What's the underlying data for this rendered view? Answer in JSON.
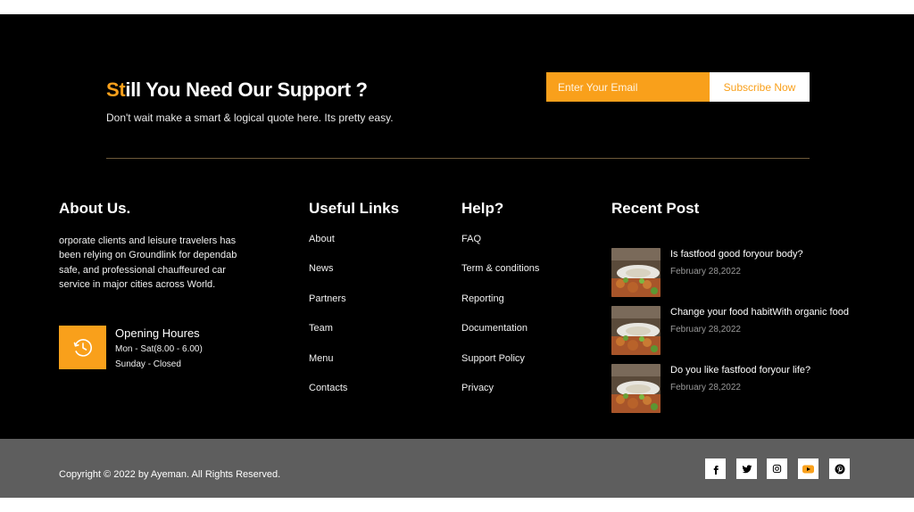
{
  "support": {
    "title_accent": "St",
    "title_rest": "ill You Need Our Support ?",
    "subtitle": "Don't wait make a smart & logical quote here. Its pretty easy.",
    "email_placeholder": "Enter Your Email",
    "subscribe_label": "Subscribe Now"
  },
  "about": {
    "title": "About Us.",
    "text": "orporate clients and leisure travelers has been relying on Groundlink for dependab safe, and professional chauffeured car service in major cities across World.",
    "hours_icon": "clock-icon",
    "hours_title": "Opening Houres",
    "hours_line1": "Mon - Sat(8.00 - 6.00)",
    "hours_line2": "Sunday - Closed"
  },
  "useful_links": {
    "title": "Useful Links",
    "items": [
      "About",
      "News",
      "Partners",
      "Team",
      "Menu",
      "Contacts"
    ]
  },
  "help": {
    "title": "Help?",
    "items": [
      "FAQ",
      "Term & conditions",
      "Reporting",
      "Documentation",
      "Support Policy",
      "Privacy"
    ]
  },
  "recent_posts": {
    "title": "Recent Post",
    "posts": [
      {
        "title": "Is fastfood good foryour body?",
        "date": "February 28,2022"
      },
      {
        "title": "Change your food habitWith organic food",
        "date": "February 28,2022"
      },
      {
        "title": "Do you like fastfood foryour life?",
        "date": "February 28,2022"
      }
    ]
  },
  "bottom": {
    "copyright": "Copyright © 2022 by Ayeman. All Rights Reserved.",
    "social_icons": [
      "facebook-icon",
      "twitter-icon",
      "instagram-icon",
      "youtube-icon",
      "pinterest-icon"
    ]
  },
  "colors": {
    "accent": "#f9a01b",
    "footer_bg": "#000000",
    "bottom_bar_bg": "#5e5e5e",
    "date_text": "#9a9a9a"
  }
}
